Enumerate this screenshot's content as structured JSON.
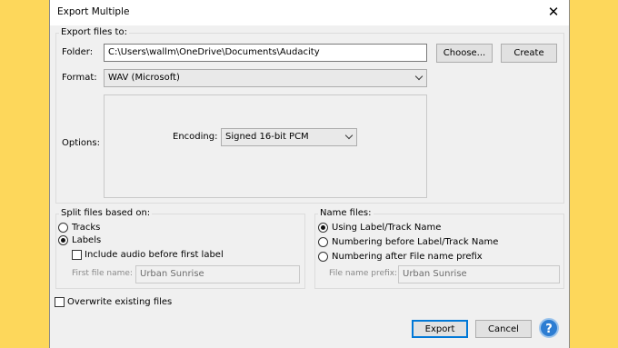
{
  "dialog": {
    "title": "Export Multiple"
  },
  "export_files": {
    "group_label": "Export files to:",
    "folder_label": "Folder:",
    "folder_value": "C:\\Users\\wallm\\OneDrive\\Documents\\Audacity",
    "choose_label": "Choose...",
    "create_label": "Create",
    "format_label": "Format:",
    "format_value": "WAV (Microsoft)",
    "options_label": "Options:",
    "encoding_label": "Encoding:",
    "encoding_value": "Signed 16-bit PCM"
  },
  "split": {
    "group_label": "Split files based on:",
    "tracks_label": "Tracks",
    "labels_label": "Labels",
    "selected": "Labels",
    "include_audio_label": "Include audio before first label",
    "include_audio_checked": false,
    "first_file_name_label": "First file name:",
    "first_file_name_value": "Urban Sunrise"
  },
  "name_files": {
    "group_label": "Name files:",
    "option1": "Using Label/Track Name",
    "option2": "Numbering before Label/Track Name",
    "option3": "Numbering after File name prefix",
    "selected": "Using Label/Track Name",
    "prefix_label": "File name prefix:",
    "prefix_value": "Urban Sunrise"
  },
  "overwrite_label": "Overwrite existing files",
  "overwrite_checked": false,
  "buttons": {
    "export": "Export",
    "cancel": "Cancel",
    "help": "?"
  },
  "colors": {
    "background": "#fdd75b",
    "accent": "#0078d7",
    "help": "#2d7dd2"
  }
}
